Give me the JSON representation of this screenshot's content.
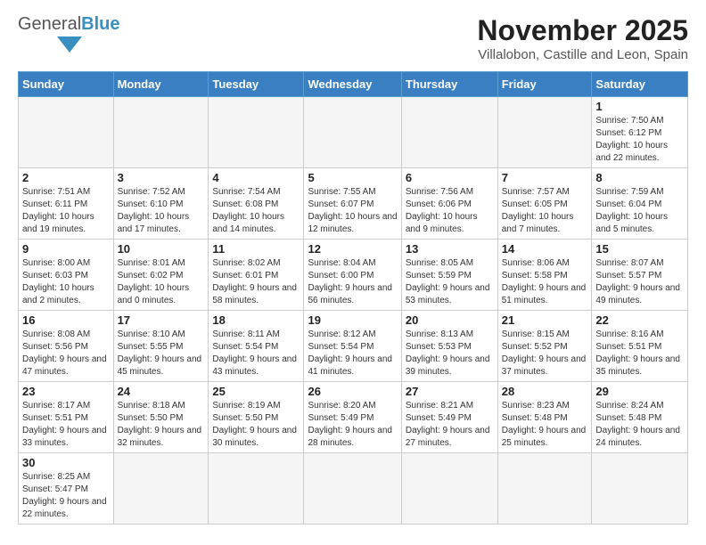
{
  "header": {
    "month_title": "November 2025",
    "subtitle": "Villalobon, Castille and Leon, Spain",
    "logo_general": "General",
    "logo_blue": "Blue"
  },
  "weekdays": [
    "Sunday",
    "Monday",
    "Tuesday",
    "Wednesday",
    "Thursday",
    "Friday",
    "Saturday"
  ],
  "weeks": [
    [
      {
        "day": "",
        "info": "",
        "empty": true
      },
      {
        "day": "",
        "info": "",
        "empty": true
      },
      {
        "day": "",
        "info": "",
        "empty": true
      },
      {
        "day": "",
        "info": "",
        "empty": true
      },
      {
        "day": "",
        "info": "",
        "empty": true
      },
      {
        "day": "",
        "info": "",
        "empty": true
      },
      {
        "day": "1",
        "info": "Sunrise: 7:50 AM\nSunset: 6:12 PM\nDaylight: 10 hours and 22 minutes."
      }
    ],
    [
      {
        "day": "2",
        "info": "Sunrise: 7:51 AM\nSunset: 6:11 PM\nDaylight: 10 hours and 19 minutes."
      },
      {
        "day": "3",
        "info": "Sunrise: 7:52 AM\nSunset: 6:10 PM\nDaylight: 10 hours and 17 minutes."
      },
      {
        "day": "4",
        "info": "Sunrise: 7:54 AM\nSunset: 6:08 PM\nDaylight: 10 hours and 14 minutes."
      },
      {
        "day": "5",
        "info": "Sunrise: 7:55 AM\nSunset: 6:07 PM\nDaylight: 10 hours and 12 minutes."
      },
      {
        "day": "6",
        "info": "Sunrise: 7:56 AM\nSunset: 6:06 PM\nDaylight: 10 hours and 9 minutes."
      },
      {
        "day": "7",
        "info": "Sunrise: 7:57 AM\nSunset: 6:05 PM\nDaylight: 10 hours and 7 minutes."
      },
      {
        "day": "8",
        "info": "Sunrise: 7:59 AM\nSunset: 6:04 PM\nDaylight: 10 hours and 5 minutes."
      }
    ],
    [
      {
        "day": "9",
        "info": "Sunrise: 8:00 AM\nSunset: 6:03 PM\nDaylight: 10 hours and 2 minutes."
      },
      {
        "day": "10",
        "info": "Sunrise: 8:01 AM\nSunset: 6:02 PM\nDaylight: 10 hours and 0 minutes."
      },
      {
        "day": "11",
        "info": "Sunrise: 8:02 AM\nSunset: 6:01 PM\nDaylight: 9 hours and 58 minutes."
      },
      {
        "day": "12",
        "info": "Sunrise: 8:04 AM\nSunset: 6:00 PM\nDaylight: 9 hours and 56 minutes."
      },
      {
        "day": "13",
        "info": "Sunrise: 8:05 AM\nSunset: 5:59 PM\nDaylight: 9 hours and 53 minutes."
      },
      {
        "day": "14",
        "info": "Sunrise: 8:06 AM\nSunset: 5:58 PM\nDaylight: 9 hours and 51 minutes."
      },
      {
        "day": "15",
        "info": "Sunrise: 8:07 AM\nSunset: 5:57 PM\nDaylight: 9 hours and 49 minutes."
      }
    ],
    [
      {
        "day": "16",
        "info": "Sunrise: 8:08 AM\nSunset: 5:56 PM\nDaylight: 9 hours and 47 minutes."
      },
      {
        "day": "17",
        "info": "Sunrise: 8:10 AM\nSunset: 5:55 PM\nDaylight: 9 hours and 45 minutes."
      },
      {
        "day": "18",
        "info": "Sunrise: 8:11 AM\nSunset: 5:54 PM\nDaylight: 9 hours and 43 minutes."
      },
      {
        "day": "19",
        "info": "Sunrise: 8:12 AM\nSunset: 5:54 PM\nDaylight: 9 hours and 41 minutes."
      },
      {
        "day": "20",
        "info": "Sunrise: 8:13 AM\nSunset: 5:53 PM\nDaylight: 9 hours and 39 minutes."
      },
      {
        "day": "21",
        "info": "Sunrise: 8:15 AM\nSunset: 5:52 PM\nDaylight: 9 hours and 37 minutes."
      },
      {
        "day": "22",
        "info": "Sunrise: 8:16 AM\nSunset: 5:51 PM\nDaylight: 9 hours and 35 minutes."
      }
    ],
    [
      {
        "day": "23",
        "info": "Sunrise: 8:17 AM\nSunset: 5:51 PM\nDaylight: 9 hours and 33 minutes."
      },
      {
        "day": "24",
        "info": "Sunrise: 8:18 AM\nSunset: 5:50 PM\nDaylight: 9 hours and 32 minutes."
      },
      {
        "day": "25",
        "info": "Sunrise: 8:19 AM\nSunset: 5:50 PM\nDaylight: 9 hours and 30 minutes."
      },
      {
        "day": "26",
        "info": "Sunrise: 8:20 AM\nSunset: 5:49 PM\nDaylight: 9 hours and 28 minutes."
      },
      {
        "day": "27",
        "info": "Sunrise: 8:21 AM\nSunset: 5:49 PM\nDaylight: 9 hours and 27 minutes."
      },
      {
        "day": "28",
        "info": "Sunrise: 8:23 AM\nSunset: 5:48 PM\nDaylight: 9 hours and 25 minutes."
      },
      {
        "day": "29",
        "info": "Sunrise: 8:24 AM\nSunset: 5:48 PM\nDaylight: 9 hours and 24 minutes."
      }
    ],
    [
      {
        "day": "30",
        "info": "Sunrise: 8:25 AM\nSunset: 5:47 PM\nDaylight: 9 hours and 22 minutes."
      },
      {
        "day": "",
        "info": "",
        "empty": true
      },
      {
        "day": "",
        "info": "",
        "empty": true
      },
      {
        "day": "",
        "info": "",
        "empty": true
      },
      {
        "day": "",
        "info": "",
        "empty": true
      },
      {
        "day": "",
        "info": "",
        "empty": true
      },
      {
        "day": "",
        "info": "",
        "empty": true
      }
    ]
  ]
}
